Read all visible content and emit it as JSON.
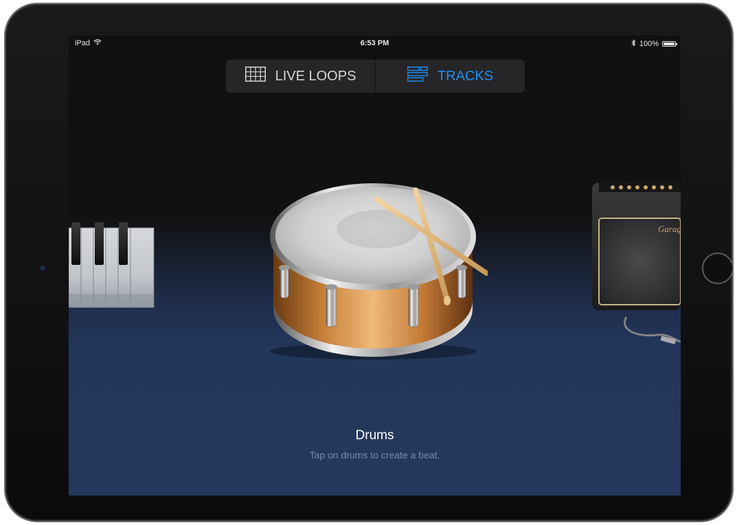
{
  "status_bar": {
    "device": "iPad",
    "time": "6:53 PM",
    "battery_text": "100%",
    "battery_level": 1.0,
    "icons": [
      "wifi-icon",
      "bluetooth-icon",
      "battery-icon"
    ]
  },
  "tabs": [
    {
      "label": "LIVE LOOPS",
      "icon": "grid-icon",
      "active": false
    },
    {
      "label": "TRACKS",
      "icon": "tracks-icon",
      "active": true
    }
  ],
  "colors": {
    "accent": "#1e8ef5",
    "screen_top": "#111111",
    "screen_bottom": "#24385b",
    "subtitle": "#7c8aa5"
  },
  "instruments": [
    "keyboard",
    "drums",
    "guitar-amp"
  ],
  "selected_instrument": {
    "title": "Drums",
    "subtitle": "Tap on drums to create a beat."
  },
  "amp_logo_text": "Garag"
}
